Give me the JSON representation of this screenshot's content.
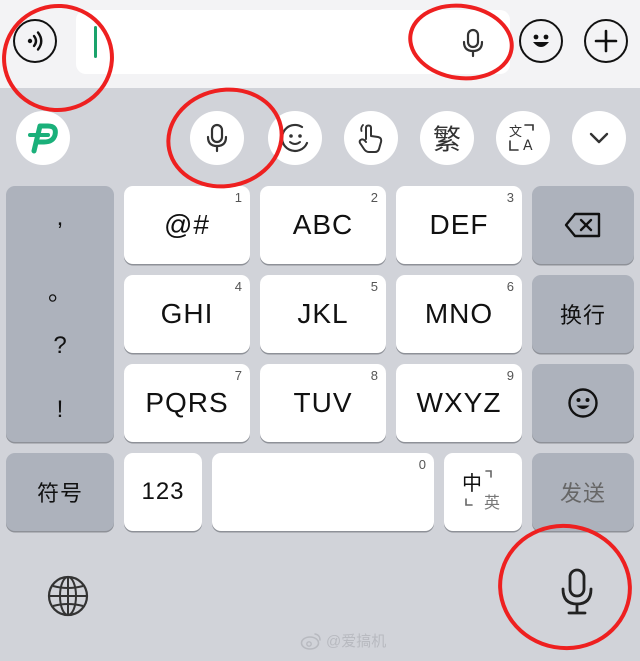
{
  "toolbar_keys": {
    "traditional": "繁"
  },
  "keys": {
    "row1": [
      {
        "label": "@#",
        "num": "1"
      },
      {
        "label": "ABC",
        "num": "2"
      },
      {
        "label": "DEF",
        "num": "3"
      }
    ],
    "row2": [
      {
        "label": "GHI",
        "num": "4"
      },
      {
        "label": "JKL",
        "num": "5"
      },
      {
        "label": "MNO",
        "num": "6"
      }
    ],
    "row3": [
      {
        "label": "PQRS",
        "num": "7"
      },
      {
        "label": "TUV",
        "num": "8"
      },
      {
        "label": "WXYZ",
        "num": "9"
      }
    ],
    "newline": "换行",
    "symbols": "符号",
    "numbers": "123",
    "space_num": "0",
    "lang_zh": "中",
    "lang_en": "英",
    "send": "发送"
  },
  "punctuation": [
    ",",
    "。",
    "?",
    "!"
  ],
  "watermark": "@爱搞机",
  "colors": {
    "annotation": "#ee2020",
    "caret": "#1aa36b",
    "brand": "#1ab07a"
  },
  "icons": {
    "voice_message": "voice-message-icon",
    "mic": "microphone-icon",
    "emoji": "emoji-icon",
    "plus": "plus-icon",
    "brand_logo": "keyboard-brand-logo",
    "sticker": "sticker-icon",
    "handwriting": "handwriting-icon",
    "translate": "translate-icon",
    "collapse": "chevron-down-icon",
    "backspace": "backspace-icon",
    "globe": "globe-icon",
    "weibo": "weibo-logo"
  }
}
